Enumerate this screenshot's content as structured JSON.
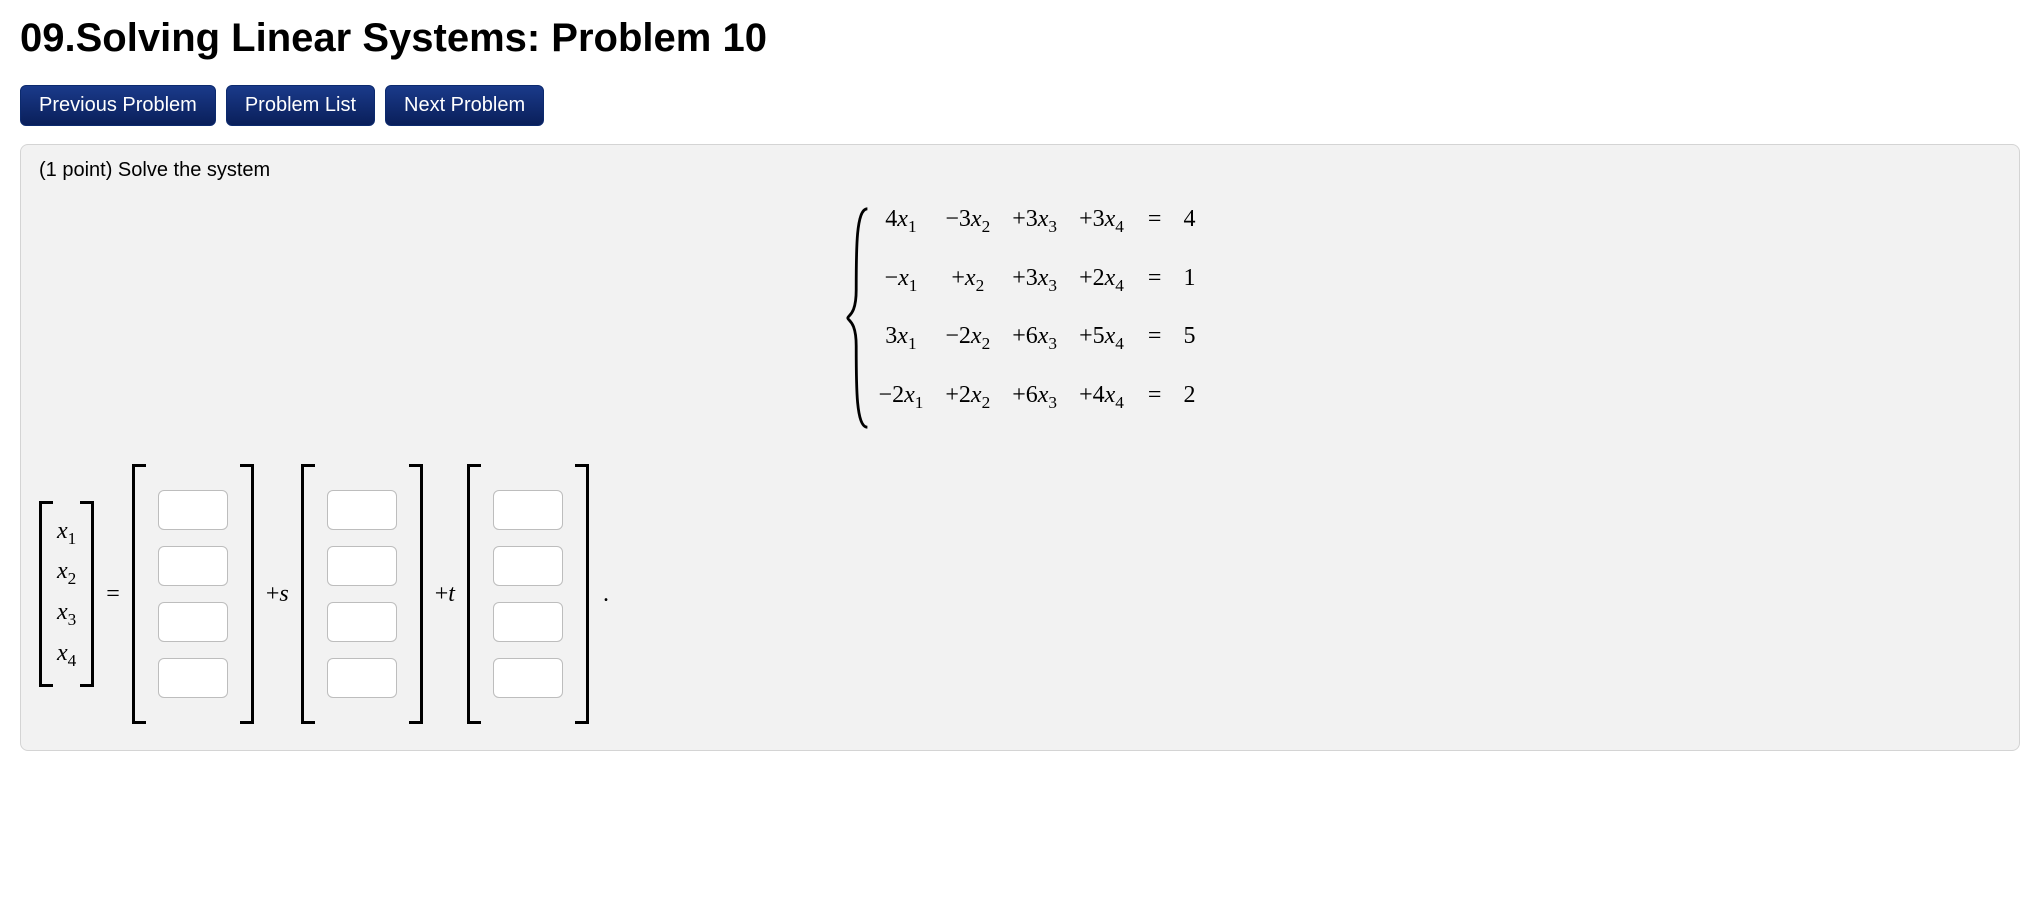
{
  "title": "09.Solving Linear Systems: Problem 10",
  "nav": {
    "prev": "Previous Problem",
    "list": "Problem List",
    "next": "Next Problem"
  },
  "prompt": "(1 point) Solve the system",
  "system": {
    "rows": [
      {
        "c1": "4",
        "c2": "−3",
        "c3": "+3",
        "c4": "+3",
        "rhs": "4"
      },
      {
        "c1": "−",
        "c2": "+",
        "c3": "+3",
        "c4": "+2",
        "rhs": "1"
      },
      {
        "c1": "3",
        "c2": "−2",
        "c3": "+6",
        "c4": "+5",
        "rhs": "5"
      },
      {
        "c1": "−2",
        "c2": "+2",
        "c3": "+6",
        "c4": "+4",
        "rhs": "2"
      }
    ],
    "vars": [
      "x",
      "x",
      "x",
      "x"
    ],
    "subs": [
      "1",
      "2",
      "3",
      "4"
    ],
    "eq": "="
  },
  "answer": {
    "lhs_labels": [
      "x",
      "x",
      "x",
      "x"
    ],
    "lhs_subs": [
      "1",
      "2",
      "3",
      "4"
    ],
    "equals": "=",
    "op_s": "+s",
    "op_t": "+t",
    "period": "."
  }
}
